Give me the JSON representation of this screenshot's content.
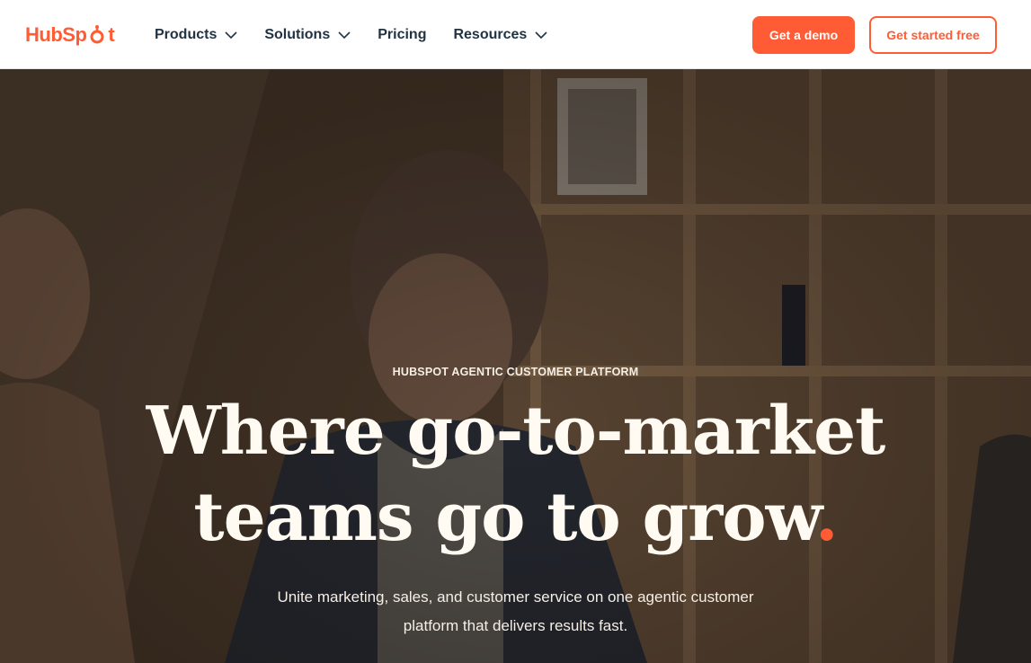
{
  "header": {
    "logo_text_left": "Hub",
    "logo_text_right": "t",
    "logo_text_mid": "Sp",
    "nav": [
      {
        "label": "Products",
        "has_dropdown": true
      },
      {
        "label": "Solutions",
        "has_dropdown": true
      },
      {
        "label": "Pricing",
        "has_dropdown": false
      },
      {
        "label": "Resources",
        "has_dropdown": true
      }
    ],
    "demo_button": "Get a demo",
    "free_button": "Get started free"
  },
  "hero": {
    "eyebrow": "HUBSPOT AGENTIC CUSTOMER PLATFORM",
    "headline_line1": "Where go-to-market",
    "headline_line2": "teams go to grow",
    "headline_dot": ".",
    "subtext": "Unite marketing, sales, and customer service on one agentic customer platform that delivers results fast."
  },
  "colors": {
    "brand": "#ff5c35",
    "nav_text": "#213343"
  }
}
